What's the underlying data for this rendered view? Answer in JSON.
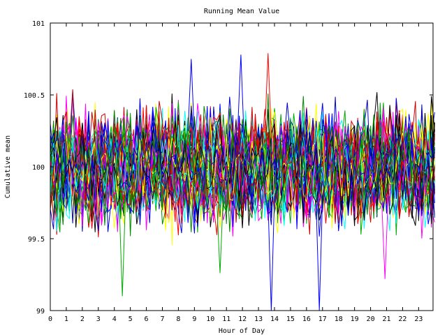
{
  "chart_data": {
    "type": "line",
    "title": "Running Mean Value",
    "xlabel": "Hour of Day",
    "ylabel": "Cumulative mean",
    "xlim": [
      0,
      23.9
    ],
    "ylim": [
      99,
      101
    ],
    "x_ticks": [
      0,
      1,
      2,
      3,
      4,
      5,
      6,
      7,
      8,
      9,
      10,
      11,
      12,
      13,
      14,
      15,
      16,
      17,
      18,
      19,
      20,
      21,
      22,
      23
    ],
    "y_ticks": [
      99,
      99.5,
      100,
      100.5,
      101
    ],
    "y_tick_labels": [
      "99",
      "99.5",
      "100",
      "100.5",
      "101"
    ],
    "grid": false,
    "legend": "none",
    "series_count": 60,
    "samples_per_hour": 5,
    "center": 100,
    "typical_spread": 0.2,
    "series_colors": [
      "#ff0000",
      "#00aa00",
      "#0000ff",
      "#ff00ff",
      "#00ffff",
      "#ffff00",
      "#000000",
      "#cc0000",
      "#0000cc",
      "#008800"
    ],
    "series": [
      {
        "color": "#0000ff",
        "x": [
          13.8
        ],
        "y": [
          99.0
        ]
      },
      {
        "color": "#0000ff",
        "x": [
          16.8
        ],
        "y": [
          99.0
        ]
      },
      {
        "color": "#0000ff",
        "x": [
          11.9
        ],
        "y": [
          100.78
        ]
      },
      {
        "color": "#ff0000",
        "x": [
          13.6
        ],
        "y": [
          100.79
        ]
      },
      {
        "color": "#00aa00",
        "x": [
          4.5
        ],
        "y": [
          99.1
        ]
      },
      {
        "color": "#0000ff",
        "x": [
          8.8
        ],
        "y": [
          100.75
        ]
      },
      {
        "color": "#ff00ff",
        "x": [
          20.9
        ],
        "y": [
          99.22
        ]
      },
      {
        "color": "#00aa00",
        "x": [
          10.6
        ],
        "y": [
          99.26
        ]
      }
    ]
  }
}
